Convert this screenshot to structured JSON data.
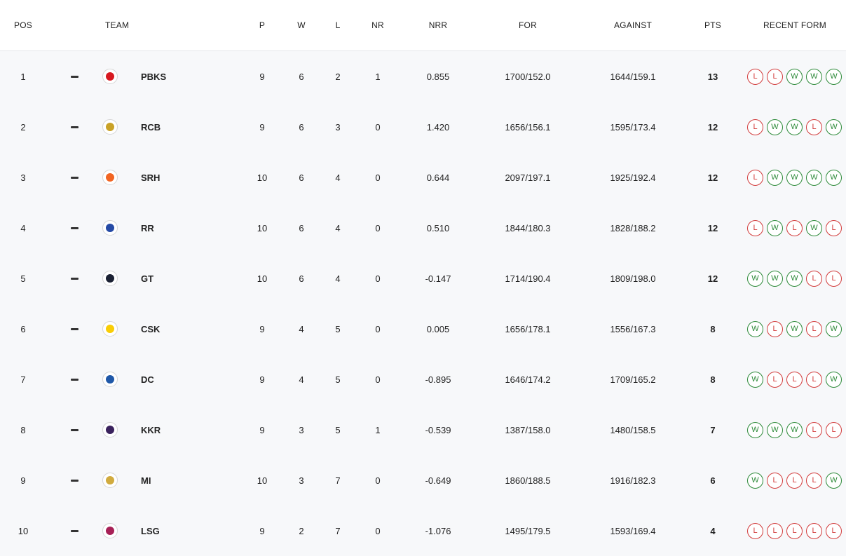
{
  "headers": {
    "pos": "POS",
    "team": "TEAM",
    "p": "P",
    "w": "W",
    "l": "L",
    "nr": "NR",
    "nrr": "NRR",
    "for": "FOR",
    "against": "AGAINST",
    "pts": "PTS",
    "recent_form": "RECENT FORM"
  },
  "colors": {
    "win": "#2e8b3a",
    "loss": "#d23c3c"
  },
  "rows": [
    {
      "pos": "1",
      "team": "PBKS",
      "p": "9",
      "w": "6",
      "l": "2",
      "nr": "1",
      "nrr": "0.855",
      "for": "1700/152.0",
      "against": "1644/159.1",
      "pts": "13",
      "form": [
        "L",
        "L",
        "W",
        "W",
        "W"
      ],
      "logo_color": "#d71920"
    },
    {
      "pos": "2",
      "team": "RCB",
      "p": "9",
      "w": "6",
      "l": "3",
      "nr": "0",
      "nrr": "1.420",
      "for": "1656/156.1",
      "against": "1595/173.4",
      "pts": "12",
      "form": [
        "L",
        "W",
        "W",
        "L",
        "W"
      ],
      "logo_color": "#c9a227"
    },
    {
      "pos": "3",
      "team": "SRH",
      "p": "10",
      "w": "6",
      "l": "4",
      "nr": "0",
      "nrr": "0.644",
      "for": "2097/197.1",
      "against": "1925/192.4",
      "pts": "12",
      "form": [
        "L",
        "W",
        "W",
        "W",
        "W"
      ],
      "logo_color": "#f26522"
    },
    {
      "pos": "4",
      "team": "RR",
      "p": "10",
      "w": "6",
      "l": "4",
      "nr": "0",
      "nrr": "0.510",
      "for": "1844/180.3",
      "against": "1828/188.2",
      "pts": "12",
      "form": [
        "L",
        "W",
        "L",
        "W",
        "L"
      ],
      "logo_color": "#254aa5"
    },
    {
      "pos": "5",
      "team": "GT",
      "p": "10",
      "w": "6",
      "l": "4",
      "nr": "0",
      "nrr": "-0.147",
      "for": "1714/190.4",
      "against": "1809/198.0",
      "pts": "12",
      "form": [
        "W",
        "W",
        "W",
        "L",
        "L"
      ],
      "logo_color": "#1b2133"
    },
    {
      "pos": "6",
      "team": "CSK",
      "p": "9",
      "w": "4",
      "l": "5",
      "nr": "0",
      "nrr": "0.005",
      "for": "1656/178.1",
      "against": "1556/167.3",
      "pts": "8",
      "form": [
        "W",
        "L",
        "W",
        "L",
        "W"
      ],
      "logo_color": "#f9cd05"
    },
    {
      "pos": "7",
      "team": "DC",
      "p": "9",
      "w": "4",
      "l": "5",
      "nr": "0",
      "nrr": "-0.895",
      "for": "1646/174.2",
      "against": "1709/165.2",
      "pts": "8",
      "form": [
        "W",
        "L",
        "L",
        "L",
        "W"
      ],
      "logo_color": "#1f58a8"
    },
    {
      "pos": "8",
      "team": "KKR",
      "p": "9",
      "w": "3",
      "l": "5",
      "nr": "1",
      "nrr": "-0.539",
      "for": "1387/158.0",
      "against": "1480/158.5",
      "pts": "7",
      "form": [
        "W",
        "W",
        "W",
        "L",
        "L"
      ],
      "logo_color": "#3a225d"
    },
    {
      "pos": "9",
      "team": "MI",
      "p": "10",
      "w": "3",
      "l": "7",
      "nr": "0",
      "nrr": "-0.649",
      "for": "1860/188.5",
      "against": "1916/182.3",
      "pts": "6",
      "form": [
        "W",
        "L",
        "L",
        "L",
        "W"
      ],
      "logo_color": "#d1ab3e"
    },
    {
      "pos": "10",
      "team": "LSG",
      "p": "9",
      "w": "2",
      "l": "7",
      "nr": "0",
      "nrr": "-1.076",
      "for": "1495/179.5",
      "against": "1593/169.4",
      "pts": "4",
      "form": [
        "L",
        "L",
        "L",
        "L",
        "L"
      ],
      "logo_color": "#a72056"
    }
  ]
}
